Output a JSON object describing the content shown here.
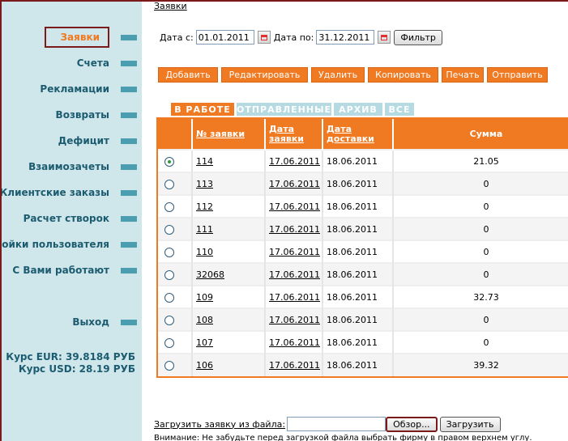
{
  "breadcrumb": "Заявки",
  "sidebar": {
    "items": [
      {
        "label": "Заявки",
        "active": true
      },
      {
        "label": "Счета"
      },
      {
        "label": "Рекламации"
      },
      {
        "label": "Возвраты"
      },
      {
        "label": "Дефицит"
      },
      {
        "label": "Взаимозачеты"
      },
      {
        "label": "Клиентские заказы"
      },
      {
        "label": "Расчет створок"
      },
      {
        "label": "Настройки пользователя"
      },
      {
        "label": "С Вами работают"
      },
      {
        "label": "Выход"
      }
    ],
    "rates": {
      "eur": "Курс EUR: 39.8184 РУБ",
      "usd": "Курс USD: 28.19 РУБ"
    }
  },
  "filter": {
    "date_from_label": "Дата с:",
    "date_from": "01.01.2011",
    "date_to_label": "Дата по:",
    "date_to": "31.12.2011",
    "button": "Фильтр"
  },
  "actions": [
    "Добавить",
    "Редактировать",
    "Удалить",
    "Копировать",
    "Печать",
    "Отправить"
  ],
  "tabs": [
    "В РАБОТЕ",
    "ОТПРАВЛЕННЫЕ",
    "АРХИВ",
    "ВСЕ"
  ],
  "table": {
    "headers": {
      "number": "№ заявки",
      "date_order": "Дата заявки",
      "date_delivery": "Дата доставки",
      "sum": "Сумма"
    },
    "rows": [
      {
        "selected": true,
        "number": "114",
        "date_order": "17.06.2011",
        "date_delivery": "18.06.2011",
        "sum": "21.05"
      },
      {
        "number": "113",
        "date_order": "17.06.2011",
        "date_delivery": "18.06.2011",
        "sum": "0"
      },
      {
        "number": "112",
        "date_order": "17.06.2011",
        "date_delivery": "18.06.2011",
        "sum": "0"
      },
      {
        "number": "111",
        "date_order": "17.06.2011",
        "date_delivery": "18.06.2011",
        "sum": "0"
      },
      {
        "number": "110",
        "date_order": "17.06.2011",
        "date_delivery": "18.06.2011",
        "sum": "0"
      },
      {
        "number": "32068",
        "date_order": "17.06.2011",
        "date_delivery": "18.06.2011",
        "sum": "0"
      },
      {
        "number": "109",
        "date_order": "17.06.2011",
        "date_delivery": "18.06.2011",
        "sum": "32.73"
      },
      {
        "number": "108",
        "date_order": "17.06.2011",
        "date_delivery": "18.06.2011",
        "sum": "0"
      },
      {
        "number": "107",
        "date_order": "17.06.2011",
        "date_delivery": "18.06.2011",
        "sum": "0"
      },
      {
        "number": "106",
        "date_order": "17.06.2011",
        "date_delivery": "18.06.2011",
        "sum": "39.32"
      }
    ]
  },
  "upload": {
    "label": "Загрузить заявку из файла:",
    "browse": "Обзор...",
    "submit": "Загрузить",
    "warning": "Внимание: Не забудьте перед загрузкой файла выбрать фирму в правом верхнем углу."
  },
  "colors": {
    "accent": "#f07a22",
    "sidebar_bg": "#cfe6ea",
    "nav_text": "#1c5c70",
    "border": "#7a1a1a"
  },
  "icons": {
    "calendar": "calendar-icon",
    "radio": "radio-button"
  }
}
